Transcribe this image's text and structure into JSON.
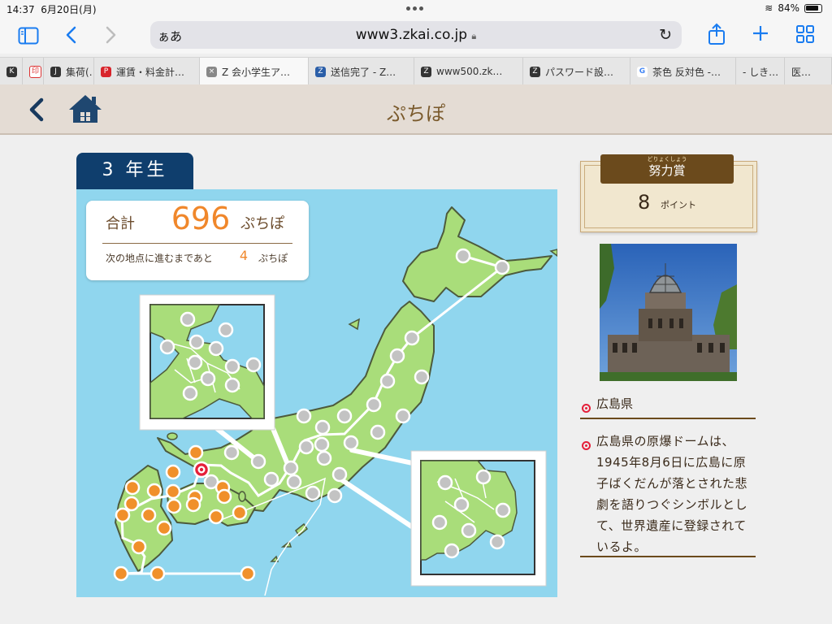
{
  "status": {
    "time": "14:37",
    "date": "6月20日(月)",
    "battery": "84%"
  },
  "browser": {
    "address_prefix": "ぁあ",
    "url": "www3.zkai.co.jp",
    "tabs": [
      {
        "fav": "K",
        "label": ""
      },
      {
        "fav": "",
        "label": ""
      },
      {
        "fav": "J",
        "label": "集荷(…"
      },
      {
        "fav": "",
        "label": "運賃・料金計…"
      },
      {
        "fav": "",
        "label": "Z 会小学生ア…"
      },
      {
        "fav": "",
        "label": "送信完了 - Z…"
      },
      {
        "fav": "Z",
        "label": "www500.zk…"
      },
      {
        "fav": "Z",
        "label": "パスワード設…"
      },
      {
        "fav": "G",
        "label": "茶色 反対色 -…"
      },
      {
        "fav": "",
        "label": "- しき…"
      },
      {
        "fav": "",
        "label": "医…"
      }
    ]
  },
  "header": {
    "title": "ぷちぽ"
  },
  "grade": {
    "label": "3 年生"
  },
  "score": {
    "total_label": "合計",
    "total_value": "696",
    "unit": "ぷちぽ",
    "next_label": "次の地点に進むまであと",
    "next_value": "4",
    "next_unit": "ぷちぽ"
  },
  "award": {
    "ruby": "どりょくしょう",
    "title": "努力賞",
    "points": "8",
    "points_label": "ポイント"
  },
  "info": {
    "prefecture": "広島県",
    "description": "広島県の原爆ドームは、1945年8月6日に広島に原子ばくだんが落とされた悲劇を語りつぐシンボルとして、世界遺産に登録されているよ。"
  },
  "map": {
    "colors": {
      "sea": "#90d6ee",
      "land": "#a9dd7a",
      "visited": "#f0902b",
      "unvisited": "#c3c3c3",
      "current": "#e5203a"
    },
    "visited_points": 20,
    "unvisited_points": 39,
    "current_prefecture": "広島県"
  }
}
